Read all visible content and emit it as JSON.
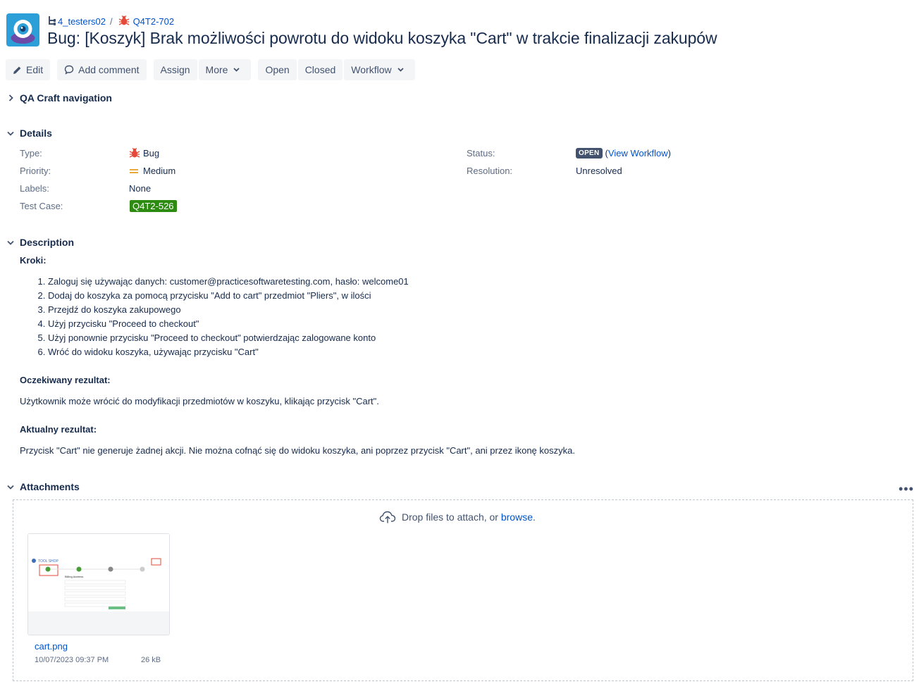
{
  "header": {
    "project_crumb": "4_testers02",
    "issue_key": "Q4T2-702",
    "title": "Bug:  [Koszyk] Brak możliwości powrotu do widoku koszyka \"Cart\" w trakcie finalizacji zakupów"
  },
  "toolbar": {
    "edit": "Edit",
    "add_comment": "Add comment",
    "assign": "Assign",
    "more": "More",
    "open": "Open",
    "closed": "Closed",
    "workflow": "Workflow"
  },
  "sections": {
    "qa_nav": "QA Craft navigation",
    "details": "Details",
    "description": "Description",
    "attachments": "Attachments"
  },
  "details": {
    "type_label": "Type:",
    "type_value": "Bug",
    "priority_label": "Priority:",
    "priority_value": "Medium",
    "labels_label": "Labels:",
    "labels_value": "None",
    "testcase_label": "Test Case:",
    "testcase_value": "Q4T2-526",
    "status_label": "Status:",
    "status_value": "OPEN",
    "view_workflow": "View Workflow",
    "paren_open": "(",
    "paren_close": ")",
    "resolution_label": "Resolution:",
    "resolution_value": "Unresolved"
  },
  "description": {
    "steps_heading": "Kroki:",
    "steps": [
      "Zaloguj się używając danych: customer@practicesoftwaretesting.com, hasło: welcome01",
      "Dodaj do koszyka za pomocą przycisku \"Add to cart\" przedmiot \"Pliers\", w ilości",
      "Przejdź do koszyka zakupowego",
      "Użyj przycisku \"Proceed to checkout\"",
      "Użyj ponownie przycisku \"Proceed to checkout\" potwierdzając zalogowane konto",
      "Wróć do widoku koszyka, używając przycisku \"Cart\""
    ],
    "expected_heading": "Oczekiwany rezultat:",
    "expected_text": "Użytkownik może wrócić do modyfikacji przedmiotów w koszyku, klikając przycisk \"Cart\".",
    "actual_heading": "Aktualny rezultat:",
    "actual_text": "Przycisk \"Cart\" nie generuje żadnej akcji. Nie można cofnąć się do widoku koszyka, ani poprzez przycisk \"Cart\", ani przez ikonę koszyka."
  },
  "attachments": {
    "drop_text": "Drop files to attach, or ",
    "browse": "browse",
    "period": ".",
    "file_name": "cart.png",
    "file_date": "10/07/2023 09:37 PM",
    "file_size": "26 kB",
    "more": "•••"
  },
  "thumbnail": {
    "logo_text": "TOOL SHOP",
    "billing_heading": "Billing Address"
  },
  "colors": {
    "link": "#0052cc",
    "bug_red": "#e5493a",
    "testcase_green": "#2e8b12",
    "open_lozenge": "#42526e",
    "priority_medium": "#e8a93a"
  }
}
